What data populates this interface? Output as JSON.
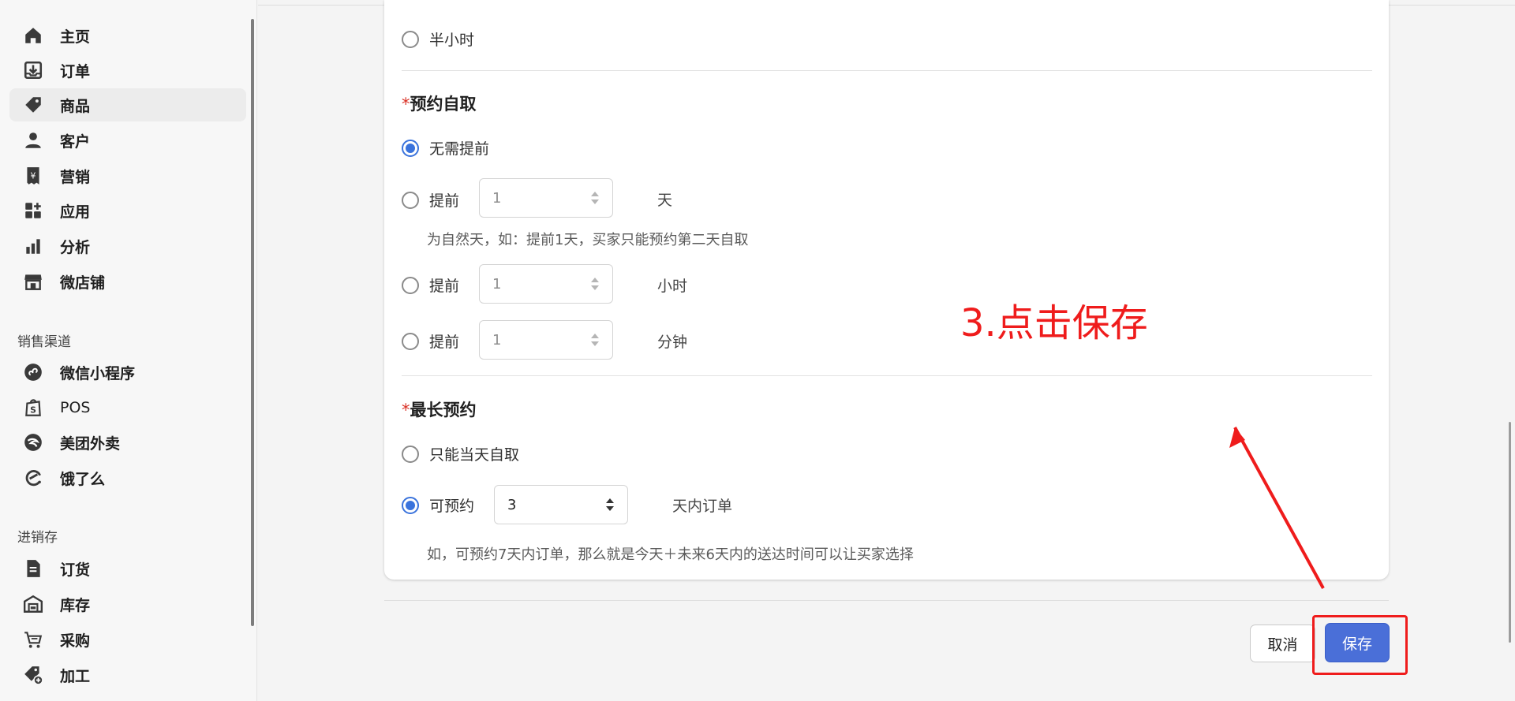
{
  "sidebar": {
    "items": [
      {
        "label": "主页",
        "icon": "home-icon"
      },
      {
        "label": "订单",
        "icon": "order-icon"
      },
      {
        "label": "商品",
        "icon": "tag-icon",
        "active": true
      },
      {
        "label": "客户",
        "icon": "person-icon"
      },
      {
        "label": "营销",
        "icon": "marketing-icon"
      },
      {
        "label": "应用",
        "icon": "apps-icon"
      },
      {
        "label": "分析",
        "icon": "bar-chart-icon"
      },
      {
        "label": "微店铺",
        "icon": "storefront-icon"
      }
    ],
    "sections": [
      {
        "title": "销售渠道",
        "items": [
          {
            "label": "微信小程序",
            "icon": "mini-program-icon"
          },
          {
            "label": "POS",
            "icon": "pos-bag-icon"
          },
          {
            "label": "美团外卖",
            "icon": "meituan-icon"
          },
          {
            "label": "饿了么",
            "icon": "eleme-icon"
          }
        ]
      },
      {
        "title": "进销存",
        "items": [
          {
            "label": "订货",
            "icon": "document-icon"
          },
          {
            "label": "库存",
            "icon": "warehouse-icon"
          },
          {
            "label": "采购",
            "icon": "cart-icon"
          },
          {
            "label": "加工",
            "icon": "tag-plus-icon"
          }
        ]
      }
    ]
  },
  "form": {
    "top_option": "半小时",
    "pickup": {
      "title": "预约自取",
      "required_mark": "*",
      "options": [
        {
          "label": "无需提前",
          "checked": true
        },
        {
          "label": "提前",
          "value": "1",
          "unit": "天",
          "checked": false
        },
        {
          "label": "提前",
          "value": "1",
          "unit": "小时",
          "checked": false
        },
        {
          "label": "提前",
          "value": "1",
          "unit": "分钟",
          "checked": false
        }
      ],
      "hint": "为自然天，如：提前1天，买家只能预约第二天自取"
    },
    "max_booking": {
      "title": "最长预约",
      "required_mark": "*",
      "option_same_day": "只能当天自取",
      "option_bookable": "可预约",
      "bookable_value": "3",
      "bookable_unit": "天内订单",
      "hint": "如，可预约7天内订单，那么就是今天＋未来6天内的送达时间可以让买家选择"
    }
  },
  "footer": {
    "cancel_label": "取消",
    "save_label": "保存"
  },
  "annotation": {
    "text": "3.点击保存",
    "color": "#ef1c1c"
  }
}
